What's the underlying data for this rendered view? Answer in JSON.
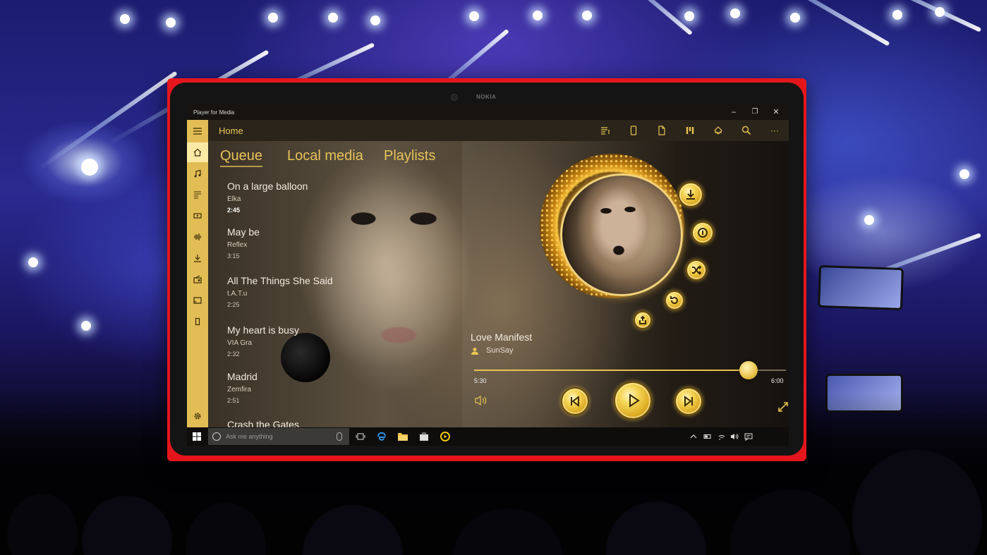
{
  "window": {
    "app_title": "Player for Media",
    "brand": "NOKIA",
    "minimize": "–",
    "maximize": "❐",
    "close": "✕"
  },
  "header": {
    "title": "Home",
    "command_icons": [
      "now-playing-list-icon",
      "device-icon",
      "file-icon",
      "equalizer-icon",
      "stream-icon",
      "search-icon",
      "more-icon"
    ],
    "more_label": "···"
  },
  "sidebar": {
    "items": [
      "menu-icon",
      "home-icon",
      "music-icon",
      "playlist-icon",
      "video-icon",
      "audio-wave-icon",
      "download-icon",
      "radio-icon",
      "cast-icon",
      "battery-icon"
    ],
    "settings": "settings-icon"
  },
  "tabs": [
    {
      "label": "Queue",
      "selected": true
    },
    {
      "label": "Local media",
      "selected": false
    },
    {
      "label": "Playlists",
      "selected": false
    }
  ],
  "queue": [
    {
      "title": "On a large balloon",
      "artist": "Elka",
      "duration": "2:45",
      "current": true
    },
    {
      "title": "May be",
      "artist": "Reflex",
      "duration": "3:15",
      "current": false
    },
    {
      "title": "All The Things She Said",
      "artist": "t.A.T.u",
      "duration": "2:25",
      "current": false
    },
    {
      "title": "My heart is busy",
      "artist": "VIA Gra",
      "duration": "2:32",
      "current": false
    },
    {
      "title": "Madrid",
      "artist": "Zemfira",
      "duration": "2:51",
      "current": false
    },
    {
      "title": "Crash the Gates",
      "artist": "",
      "duration": "",
      "current": false
    }
  ],
  "now_playing": {
    "title": "Love Manifest",
    "artist": "SunSay",
    "current_time": "5:30",
    "total_time": "6:00",
    "progress": 0.88,
    "disc_buttons": [
      "download-icon",
      "info-icon",
      "shuffle-icon",
      "repeat-icon",
      "share-icon"
    ]
  },
  "controls": {
    "previous": "previous-icon",
    "play": "play-icon",
    "next": "next-icon",
    "volume": "volume-icon",
    "fullscreen": "expand-icon"
  },
  "taskbar": {
    "search_placeholder": "Ask me anything",
    "apps": [
      "task-view-icon",
      "edge-icon",
      "file-explorer-icon",
      "store-icon",
      "player-app-icon"
    ],
    "tray": [
      "chevron-up-icon",
      "battery-icon",
      "wifi-icon",
      "volume-icon",
      "notification-icon"
    ]
  },
  "colors": {
    "accent": "#e8c350",
    "rail": "#e2bd55",
    "tablet_frame": "#e4161c"
  }
}
